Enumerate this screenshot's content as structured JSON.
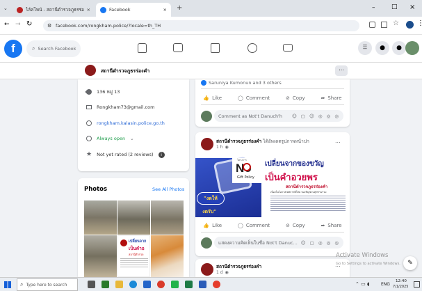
{
  "browser": {
    "tabs": [
      {
        "title": "ไลัลโหนั - สถานีตำรวจภูธรร่องคำ",
        "close": "×"
      },
      {
        "title": "Facebook",
        "close": "×"
      }
    ],
    "new_tab": "+",
    "url": "facebook.com/rongkham.police/?locale=th_TH",
    "window_controls": {
      "min": "–",
      "max": "□",
      "close": "×"
    }
  },
  "facebook": {
    "search_placeholder": "Search Facebook",
    "page_name": "สถานีตำรวจภูธรร่องคำ",
    "more": "..."
  },
  "intro": {
    "address": "136 หมู่ 13",
    "email": "Rongkham73@gmail.com",
    "website": "rongkham.kalasin.police.go.th",
    "hours": "Always open",
    "rating": "Not yet rated (2 reviews)"
  },
  "photos": {
    "title": "Photos",
    "see_all": "See All Photos"
  },
  "post_top": {
    "reactions": "Saruniya Kumonun and 3 others",
    "like": "Like",
    "comment": "Comment",
    "copy": "Copy",
    "share": "Share",
    "comment_placeholder": "Comment as Not't Danuch'h"
  },
  "post_main": {
    "author": "สถานีตำรวจภูธรร่องคำ",
    "action": "ได้อัพเดตรูปภาพหน้าปก",
    "time": "1 h",
    "image": {
      "top_line": "โครงการ",
      "no_label": "No",
      "gift_policy": "Gift Policy",
      "heading1": "เปลี่ยนจากของขวัญ",
      "heading2": "เป็นคำอวยพร",
      "station": "สถานีตำรวจภูธรร่องคำ",
      "desc": "เนื่องในโอกาสเทศกาลปีใหม่ ขอเชิญชวนทุกท่านร่วม",
      "bubble1": "\"งดให้",
      "bubble2": "งดรับ\""
    },
    "like": "Like",
    "comment": "Comment",
    "copy": "Copy",
    "share": "Share",
    "comment_placeholder": "แสดงความคิดเห็นในชื่อ Not't Danuc..."
  },
  "post_next": {
    "author": "สถานีตำรวจภูธรร่องคำ",
    "time": "1 d"
  },
  "photo_thumbs": {
    "t1": "เปลี่ยนจาก",
    "t2": "เป็นคำอ",
    "t3": "สถานีตำรวจ"
  },
  "windows": {
    "activate_title": "Activate Windows",
    "activate_sub": "Go to Settings to activate Windows.",
    "search": "Type here to search",
    "lang": "ENG",
    "time": "12:40",
    "date": "7/1/2025"
  }
}
